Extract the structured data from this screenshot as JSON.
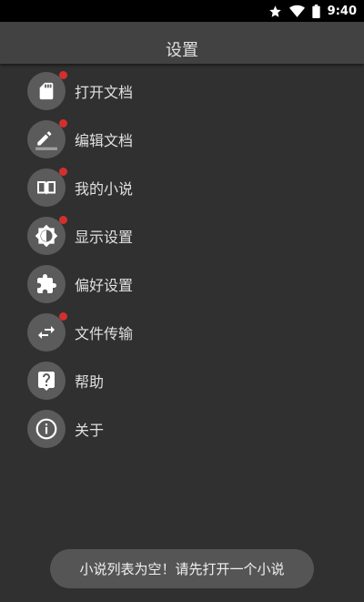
{
  "status_bar": {
    "time": "9:40",
    "icons": [
      "star-icon",
      "wifi-icon",
      "battery-icon"
    ]
  },
  "app_bar": {
    "title": "设置"
  },
  "menu": {
    "items": [
      {
        "label": "打开文档",
        "icon": "sd-card-icon",
        "badge": true
      },
      {
        "label": "编辑文档",
        "icon": "pencil-icon",
        "badge": true
      },
      {
        "label": "我的小说",
        "icon": "book-icon",
        "badge": true
      },
      {
        "label": "显示设置",
        "icon": "brightness-icon",
        "badge": true
      },
      {
        "label": "偏好设置",
        "icon": "puzzle-icon",
        "badge": false
      },
      {
        "label": "文件传输",
        "icon": "transfer-icon",
        "badge": true
      },
      {
        "label": "帮助",
        "icon": "help-icon",
        "badge": false
      },
      {
        "label": "关于",
        "icon": "info-icon",
        "badge": false
      }
    ]
  },
  "toast": {
    "message": "小说列表为空！请先打开一个小说"
  },
  "colors": {
    "background": "#303030",
    "app_bar": "#424242",
    "icon_circle": "#5b5b5b",
    "badge": "#d32f2f",
    "text": "#e0e0e0"
  }
}
